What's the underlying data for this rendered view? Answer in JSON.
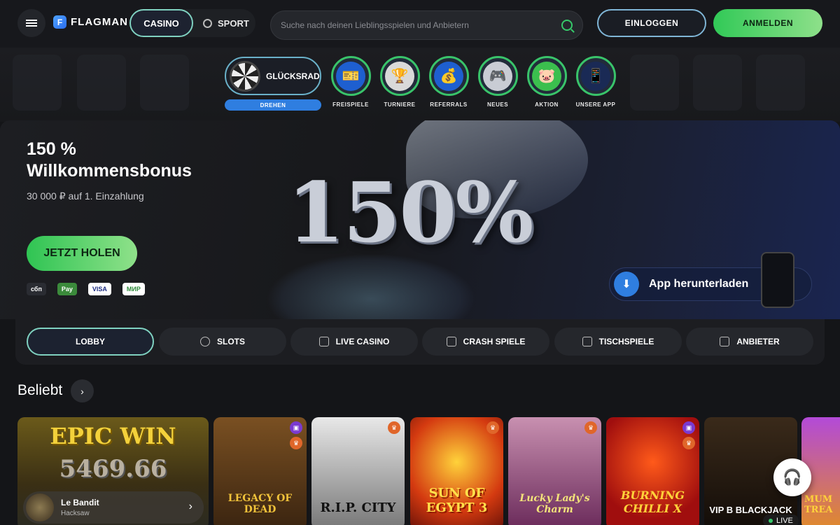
{
  "header": {
    "logo": "FLAGMAN",
    "nav_casino": "CASINO",
    "nav_sport": "SPORT",
    "search_placeholder": "Suche nach deinen Lieblingsspielen und Anbietern",
    "login": "EINLOGGEN",
    "register": "ANMELDEN"
  },
  "quick": {
    "wheel_label": "GLÜCKSRAD",
    "wheel_button": "DREHEN",
    "items": [
      {
        "label": "FREISPIELE",
        "icon": "ticket-icon"
      },
      {
        "label": "TURNIERE",
        "icon": "trophy-icon"
      },
      {
        "label": "REFERRALS",
        "icon": "money-bag-icon"
      },
      {
        "label": "NEUES",
        "icon": "gamepad-icon"
      },
      {
        "label": "AKTION",
        "icon": "piggy-bank-icon"
      },
      {
        "label": "UNSERE APP",
        "icon": "phone-icon"
      }
    ]
  },
  "hero": {
    "title": "150 % Willkommensbonus",
    "subtitle": "30 000 ₽ auf 1. Einzahlung",
    "big_text": "150%",
    "cta": "JETZT HOLEN",
    "payments": [
      "сбп",
      "Pay",
      "VISA",
      "МИР"
    ],
    "app_download": "App herunterladen"
  },
  "tabs": [
    {
      "label": "LOBBY",
      "icon": "lobby-icon"
    },
    {
      "label": "SLOTS",
      "icon": "slots-icon"
    },
    {
      "label": "LIVE CASINO",
      "icon": "live-casino-icon"
    },
    {
      "label": "CRASH SPIELE",
      "icon": "crash-icon"
    },
    {
      "label": "TISCHSPIELE",
      "icon": "table-games-icon"
    },
    {
      "label": "ANBIETER",
      "icon": "providers-icon"
    }
  ],
  "popular": {
    "title": "Beliebt",
    "featured": {
      "top_text": "EPIC WIN",
      "amount": "5469.66",
      "name": "Le Bandit",
      "provider": "Hacksaw"
    },
    "games": [
      {
        "title": "LEGACY OF DEAD",
        "color": "#5a3a1a"
      },
      {
        "title": "R.I.P. CITY",
        "color": "#3a3a3a"
      },
      {
        "title": "SUN OF EGYPT 3",
        "color": "#b5240e"
      },
      {
        "title": "Lucky Lady's Charm",
        "color": "#7a2a5a"
      },
      {
        "title": "BURNING CHILLI X",
        "color": "#a81212"
      },
      {
        "title": "VIP B BLACKJACK",
        "color": "#1a1410"
      },
      {
        "title": "MUM TREA",
        "color": "#7a3aa0"
      }
    ],
    "live_badge": "LIVE"
  }
}
